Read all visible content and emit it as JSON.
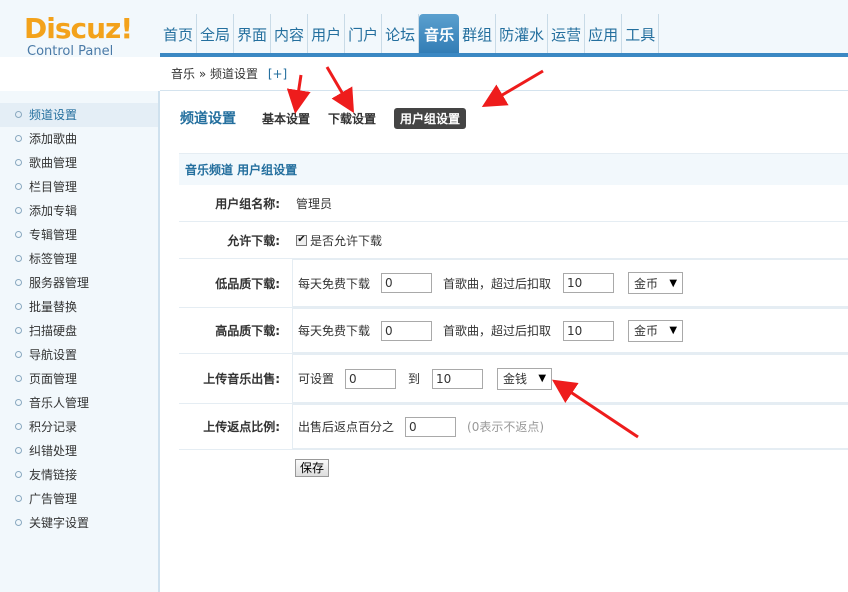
{
  "logo": {
    "main": "Discuz",
    "bang": "!",
    "sub": "Control Panel"
  },
  "nav": {
    "items": [
      "首页",
      "全局",
      "界面",
      "内容",
      "用户",
      "门户",
      "论坛",
      "音乐",
      "群组",
      "防灌水",
      "运营",
      "应用",
      "工具"
    ],
    "active_index": 7
  },
  "breadcrumb": {
    "path": "音乐 » 频道设置",
    "plus": "[+]"
  },
  "sidebar": {
    "items": [
      "频道设置",
      "添加歌曲",
      "歌曲管理",
      "栏目管理",
      "添加专辑",
      "专辑管理",
      "标签管理",
      "服务器管理",
      "批量替换",
      "扫描硬盘",
      "导航设置",
      "页面管理",
      "音乐人管理",
      "积分记录",
      "纠错处理",
      "友情链接",
      "广告管理",
      "关键字设置"
    ],
    "active_index": 0
  },
  "tabs": {
    "title": "频道设置",
    "basic": "基本设置",
    "download": "下载设置",
    "usergroup": "用户组设置"
  },
  "section": {
    "title": "音乐频道 用户组设置"
  },
  "form": {
    "group_name": {
      "label": "用户组名称:",
      "value": "管理员"
    },
    "allow_download": {
      "label": "允许下载:",
      "checkbox_label": "是否允许下载",
      "checked": true,
      "check_mark": "✔"
    },
    "low_quality": {
      "label": "低品质下载:",
      "prefix": "每天免费下载",
      "free_count": "0",
      "middle": "首歌曲，超过后扣取",
      "cost": "10",
      "currency": "金币"
    },
    "high_quality": {
      "label": "高品质下载:",
      "prefix": "每天免费下载",
      "free_count": "0",
      "middle": "首歌曲，超过后扣取",
      "cost": "10",
      "currency": "金币"
    },
    "upload_sale": {
      "label": "上传音乐出售:",
      "prefix": "可设置",
      "min": "0",
      "to": "到",
      "max": "10",
      "currency": "金钱"
    },
    "upload_rebate": {
      "label": "上传返点比例:",
      "prefix": "出售后返点百分之",
      "value": "0",
      "hint": "(0表示不返点)"
    },
    "save_label": "保存"
  },
  "colors": {
    "accent": "#246f9e",
    "logo": "#f3a21b",
    "annotation": "#ee1c1c"
  }
}
